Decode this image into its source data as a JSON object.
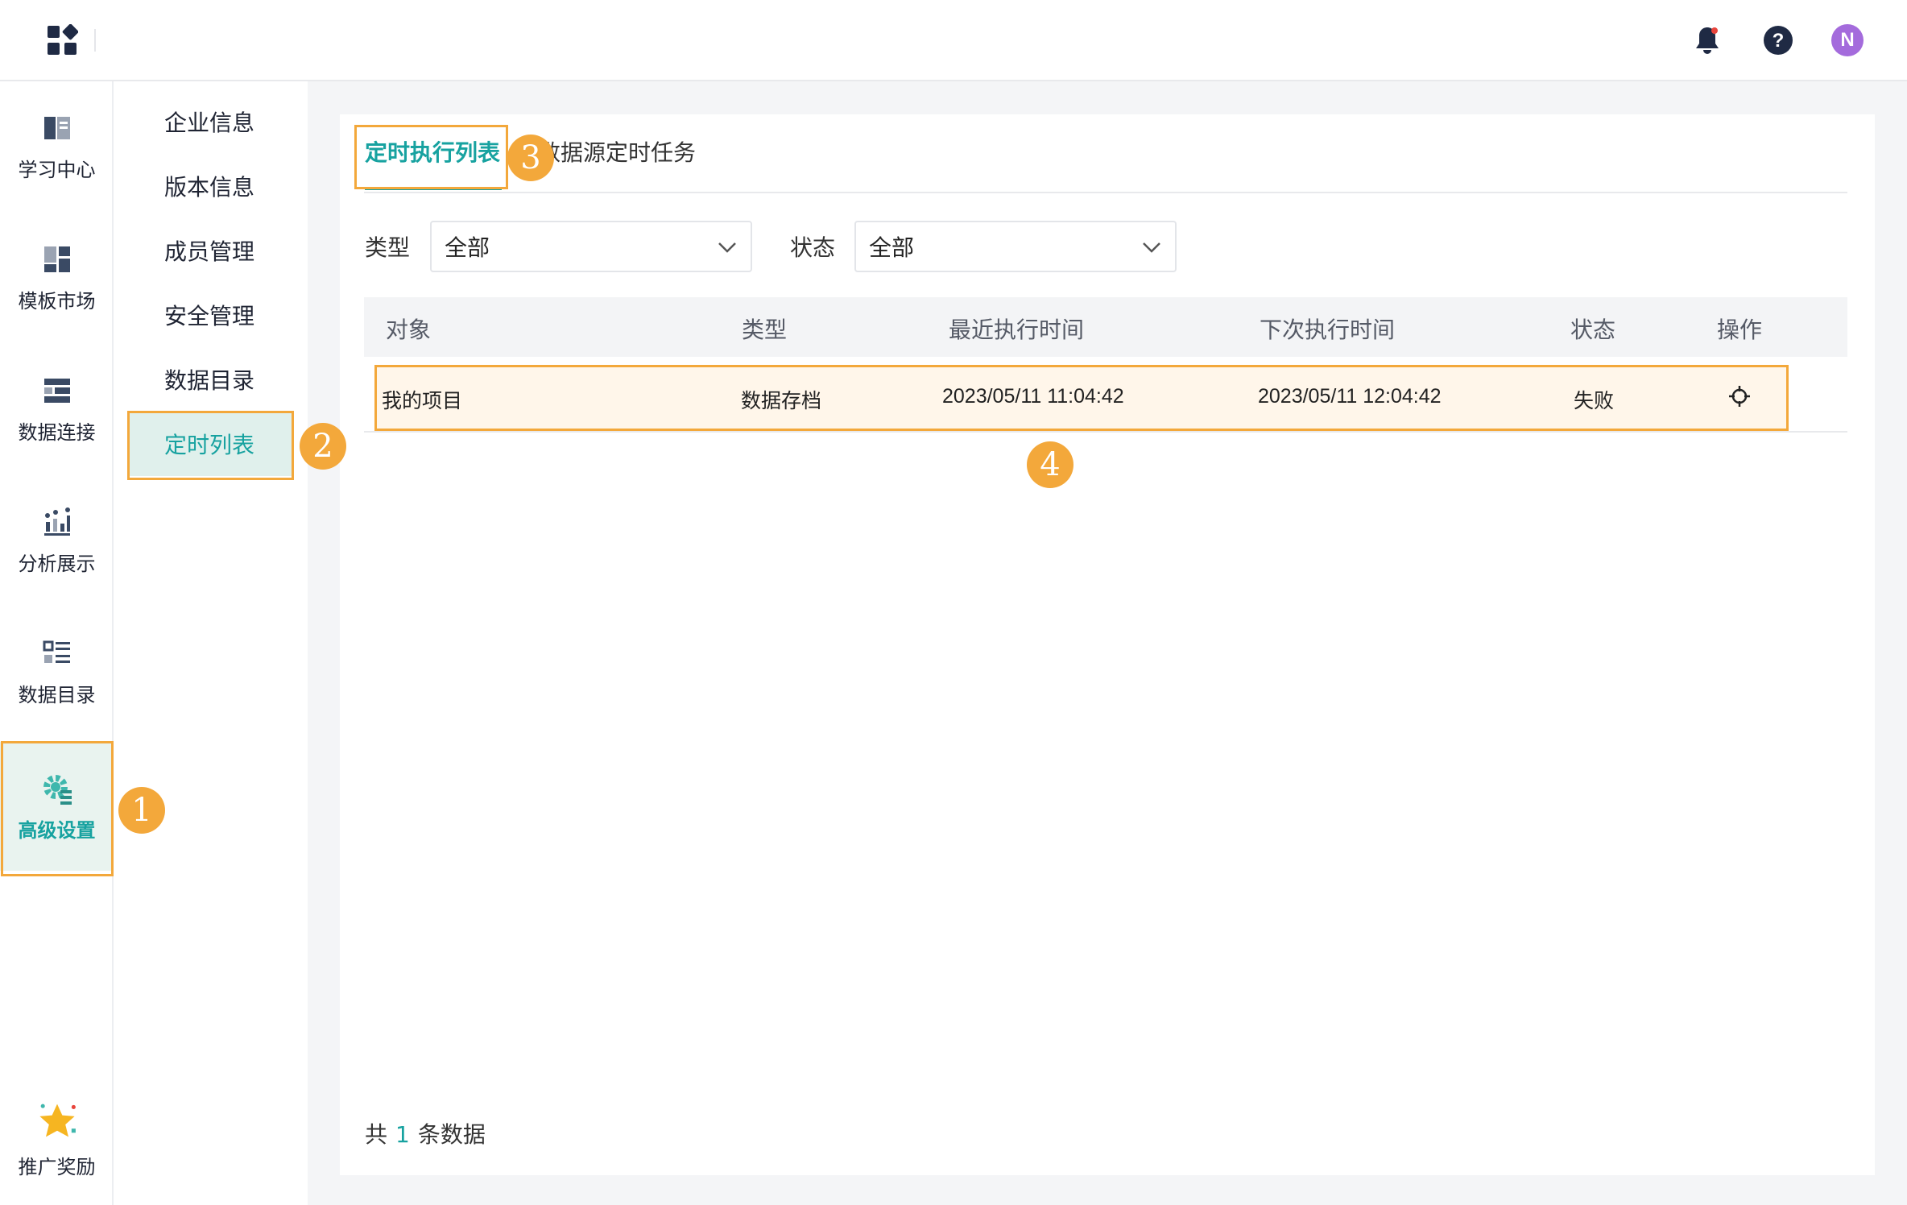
{
  "nav": {
    "items": [
      {
        "label": "学习中心",
        "icon": "book-icon"
      },
      {
        "label": "模板市场",
        "icon": "template-icon"
      },
      {
        "label": "数据连接",
        "icon": "data-connect-icon"
      },
      {
        "label": "分析展示",
        "icon": "chart-icon"
      },
      {
        "label": "数据目录",
        "icon": "catalog-icon"
      },
      {
        "label": "高级设置",
        "icon": "gear-icon",
        "active": true
      },
      {
        "label": "推广奖励",
        "icon": "star-icon"
      }
    ]
  },
  "submenu": {
    "items": [
      "企业信息",
      "版本信息",
      "成员管理",
      "安全管理",
      "数据目录",
      "定时列表"
    ],
    "active": "定时列表"
  },
  "header": {
    "avatar_letter": "N"
  },
  "tabs": {
    "active": "定时执行列表",
    "other": "数据源定时任务"
  },
  "filters": {
    "type_label": "类型",
    "type_value": "全部",
    "status_label": "状态",
    "status_value": "全部"
  },
  "table": {
    "columns": [
      "对象",
      "类型",
      "最近执行时间",
      "下次执行时间",
      "状态",
      "操作"
    ],
    "rows": [
      {
        "object": "我的项目",
        "type": "数据存档",
        "last_run": "2023/05/11 11:04:42",
        "next_run": "2023/05/11 12:04:42",
        "status": "失败"
      }
    ]
  },
  "footer": {
    "prefix": "共",
    "count": "1",
    "suffix": "条数据"
  },
  "annotations": {
    "b1": "1",
    "b2": "2",
    "b3": "3",
    "b4": "4"
  },
  "colors": {
    "accent": "#17a2a0",
    "highlight": "#f3a83b",
    "avatar": "#a46bdc"
  }
}
